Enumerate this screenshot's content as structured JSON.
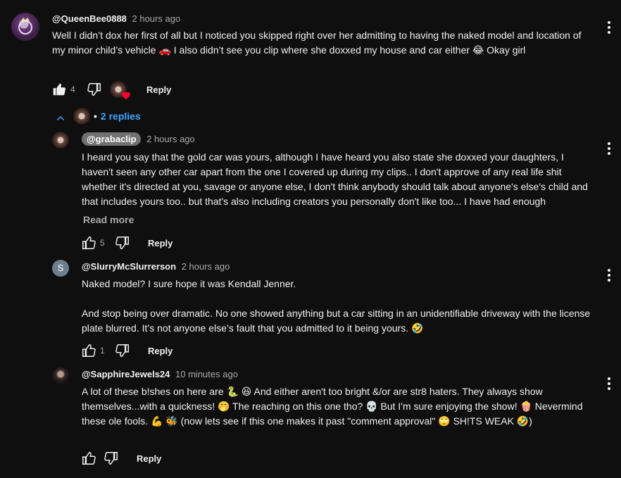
{
  "comments": [
    {
      "author": "@QueenBee0888",
      "time": "2 hours ago",
      "text": "Well I didn’t dox her first of all but I noticed you skipped right over her admitting to having the naked model and location of my minor child’s vehicle 🚗 I also didn’t see you clip where she doxxed my house and car either 😂 Okay girl",
      "likes": "4",
      "reply_label": "Reply"
    }
  ],
  "replies_toggle": {
    "label": "2 replies"
  },
  "replies": [
    {
      "author": "@grabaclip",
      "time": "2 hours ago",
      "text": "I heard you say that the gold car was yours, although I have heard you also state she doxxed your daughters, I haven't seen any other car apart from the one I covered up during my clips.. I don't approve of any real life shit whether it's directed at you, savage or anyone else, I don't think anybody should talk about anyone's else's child and that includes yours too.. but that's also including creators you personally don't like too... I have had enough",
      "read_more": "Read more",
      "likes": "5",
      "reply_label": "Reply"
    },
    {
      "author": "@SlurryMcSlurrerson",
      "avatar_letter": "S",
      "time": "2 hours ago",
      "text": "Naked model? I sure hope it was Kendall Jenner.\n\nAnd stop being over dramatic. No one showed anything but a car sitting in an unidentifiable driveway with the license plate blurred. It’s not anyone else’s fault that you admitted to it being yours. 🤣",
      "likes": "1",
      "reply_label": "Reply"
    },
    {
      "author": "@SapphireJewels24",
      "time": "10 minutes ago",
      "text": "A lot of these b!shes on here are 🐍 😆 And either aren't too bright &/or are str8 haters. They always show themselves...with a quickness! 🤭 The reaching on this one tho? 💀 But I'm sure enjoying the show! 🍿 Nevermind these ole fools. 💪 🐝 (now lets see if this one makes it past \"comment approval\" 🙄 SH!TS WEAK 🤣)",
      "likes": "",
      "reply_label": "Reply"
    }
  ],
  "colors": {
    "background": "#0f0f0f",
    "link": "#3ea6ff",
    "secondary_text": "#aaaaaa",
    "heart": "#ff0033"
  },
  "icons": [
    "like-icon",
    "dislike-icon",
    "more-vert-icon",
    "chevron-up-icon",
    "heart-icon"
  ]
}
